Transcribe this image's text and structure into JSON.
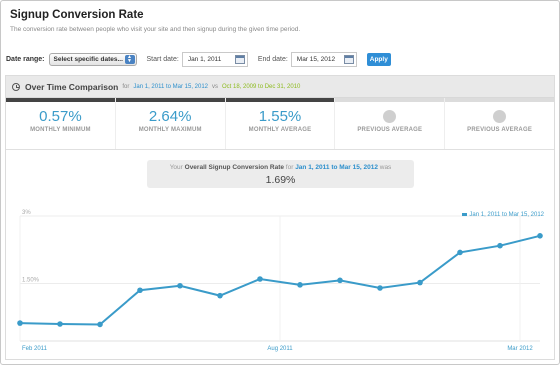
{
  "header": {
    "title": "Signup Conversion Rate",
    "subtitle": "The conversion rate between people who visit your site and then signup during the given time period."
  },
  "controls": {
    "date_range_label": "Date range:",
    "date_range_value": "Select specific dates...",
    "start_label": "Start date:",
    "start_value": "Jan 1, 2011",
    "end_label": "End date:",
    "end_value": "Mar 15, 2012",
    "apply_label": "Apply"
  },
  "panel": {
    "title": "Over Time Comparison",
    "for_text": "for",
    "range": "Jan 1, 2011 to Mar 15, 2012",
    "vs_text": "vs",
    "compare_range": "Oct 18, 2009 to Dec 31, 2010"
  },
  "metrics": [
    {
      "value": "0.57%",
      "label": "MONTHLY MINIMUM"
    },
    {
      "value": "2.64%",
      "label": "MONTHLY MAXIMUM"
    },
    {
      "value": "1.55%",
      "label": "MONTHLY AVERAGE"
    },
    {
      "value": "",
      "label": "PREVIOUS AVERAGE"
    },
    {
      "value": "",
      "label": "PREVIOUS AVERAGE"
    }
  ],
  "summary": {
    "prefix": "Your",
    "metric": "Overall Signup Conversion Rate",
    "for_text": "for",
    "range": "Jan 1, 2011 to Mar 15, 2012",
    "suffix": "was",
    "value": "1.69%"
  },
  "chart_data": {
    "type": "line",
    "x": [
      1,
      2,
      3,
      4,
      5,
      6,
      7,
      8,
      9,
      10,
      11,
      12,
      13,
      14
    ],
    "x_ticks": [
      {
        "x": 1,
        "label": "Feb 2011"
      },
      {
        "x": 7.5,
        "label": "Aug 2011"
      },
      {
        "x": 13.5,
        "label": "Mar 2012"
      }
    ],
    "y_ticks": [
      {
        "y": 1.5,
        "label": "1.50%"
      },
      {
        "y": 3,
        "label": "3%"
      }
    ],
    "ylim": [
      0.4,
      3.0
    ],
    "series": [
      {
        "name": "Jan 1, 2011 to Mar 15, 2012",
        "color": "#3a9bc9",
        "values": [
          0.62,
          0.6,
          0.59,
          1.35,
          1.45,
          1.23,
          1.6,
          1.47,
          1.57,
          1.4,
          1.52,
          2.19,
          2.34,
          2.56
        ]
      }
    ],
    "grid": "horizontal",
    "legend": "top-right"
  },
  "colors": {
    "accent": "#3a9bc9",
    "link": "#2c8fcc",
    "compare": "#8dbb1f",
    "apply": "#2f8ed6"
  },
  "icons": {
    "select_arrows": "updown-arrows-icon",
    "calendar": "calendar-icon",
    "clock": "clock-icon"
  }
}
